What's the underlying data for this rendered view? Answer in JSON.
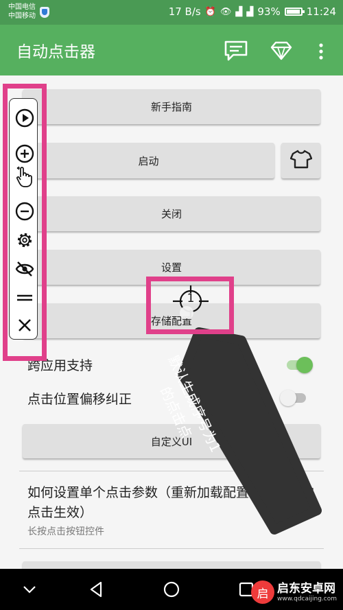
{
  "status_bar": {
    "carrier_1": "中国电信",
    "carrier_2": "中国移动",
    "net_speed": "17 B/s",
    "battery": "93%",
    "time": "11:24",
    "icons": [
      "shield-icon",
      "alarm-icon",
      "eye-icon",
      "4g-signal-icon",
      "4g-signal-icon",
      "battery-icon"
    ]
  },
  "app_bar": {
    "title": "自动点击器",
    "actions": [
      "chat-icon",
      "diamond-icon",
      "more-vert-icon"
    ]
  },
  "buttons": {
    "guide": "新手指南",
    "start": "启动",
    "close": "关闭",
    "settings": "设置",
    "save_config": "存储配置",
    "custom_ui": "自定义UI"
  },
  "switches": {
    "cross_app": {
      "label": "跨应用支持",
      "on": true
    },
    "offset_fix": {
      "label": "点击位置偏移纠正",
      "on": false
    }
  },
  "help": {
    "title": "如何设置单个点击参数（重新加载配置或新添加的点击生效）",
    "subtitle": "长按点击按钮控件"
  },
  "floating_toolbar": {
    "icons": [
      "play-icon",
      "add-icon",
      "swipe-gesture-icon",
      "remove-icon",
      "settings-gear-icon",
      "hide-eye-icon",
      "drag-handle-icon",
      "close-icon"
    ]
  },
  "click_marker": {
    "number": "1"
  },
  "annotation": {
    "line1": "默认生成序号为1",
    "line2": "的点击点"
  },
  "watermark": {
    "logo": "启",
    "name": "启东安卓网",
    "url": "www.qdcaijing.com"
  },
  "colors": {
    "status_bar": "#4a9a54",
    "app_bar": "#56b05f",
    "highlight": "#e0408a",
    "switch_on": "#6cbf5a",
    "callout": "#333333"
  }
}
